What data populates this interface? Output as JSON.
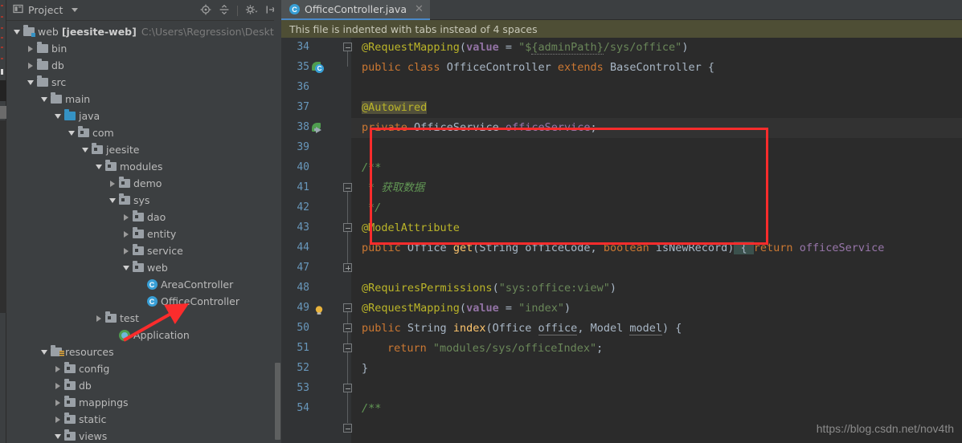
{
  "window": {
    "theme_bg": "#3c3f41",
    "editor_bg": "#2b2b2b",
    "accent": "#4a88c7",
    "highlight_box_color": "#fb2c2c"
  },
  "project_panel": {
    "title": "Project",
    "dropdown_icon": "chevron-down-icon",
    "toolbar_icons": [
      "target-locate-icon",
      "collapse-all-icon",
      "settings-gear-icon",
      "hide-panel-icon"
    ],
    "tree": [
      {
        "label": "web [jeesite-web]",
        "path_suffix": "C:\\Users\\Regression\\Desktop\\jee",
        "depth": 0,
        "twisty": "down",
        "icon": "module-folder-icon",
        "bold_part": "[jeesite-web]"
      },
      {
        "label": "bin",
        "depth": 1,
        "twisty": "right",
        "icon": "folder-icon"
      },
      {
        "label": "db",
        "depth": 1,
        "twisty": "right",
        "icon": "folder-icon"
      },
      {
        "label": "src",
        "depth": 1,
        "twisty": "down",
        "icon": "folder-icon"
      },
      {
        "label": "main",
        "depth": 2,
        "twisty": "down",
        "icon": "folder-icon"
      },
      {
        "label": "java",
        "depth": 3,
        "twisty": "down",
        "icon": "source-root-folder-icon"
      },
      {
        "label": "com",
        "depth": 4,
        "twisty": "down",
        "icon": "package-folder-icon"
      },
      {
        "label": "jeesite",
        "depth": 5,
        "twisty": "down",
        "icon": "package-folder-icon"
      },
      {
        "label": "modules",
        "depth": 6,
        "twisty": "down",
        "icon": "package-folder-icon"
      },
      {
        "label": "demo",
        "depth": 7,
        "twisty": "right",
        "icon": "package-folder-icon"
      },
      {
        "label": "sys",
        "depth": 7,
        "twisty": "down",
        "icon": "package-folder-icon"
      },
      {
        "label": "dao",
        "depth": 8,
        "twisty": "right",
        "icon": "package-folder-icon"
      },
      {
        "label": "entity",
        "depth": 8,
        "twisty": "right",
        "icon": "package-folder-icon"
      },
      {
        "label": "service",
        "depth": 8,
        "twisty": "right",
        "icon": "package-folder-icon"
      },
      {
        "label": "web",
        "depth": 8,
        "twisty": "down",
        "icon": "package-folder-icon"
      },
      {
        "label": "AreaController",
        "depth": 9,
        "twisty": "none",
        "icon": "java-class-icon"
      },
      {
        "label": "OfficeController",
        "depth": 9,
        "twisty": "none",
        "icon": "java-class-icon"
      },
      {
        "label": "test",
        "depth": 6,
        "twisty": "right",
        "icon": "package-folder-icon"
      },
      {
        "label": "Application",
        "depth": 7,
        "twisty": "none",
        "icon": "spring-application-icon"
      },
      {
        "label": "resources",
        "depth": 2,
        "twisty": "down",
        "icon": "resources-root-folder-icon"
      },
      {
        "label": "config",
        "depth": 3,
        "twisty": "right",
        "icon": "package-folder-icon"
      },
      {
        "label": "db",
        "depth": 3,
        "twisty": "right",
        "icon": "package-folder-icon"
      },
      {
        "label": "mappings",
        "depth": 3,
        "twisty": "right",
        "icon": "package-folder-icon"
      },
      {
        "label": "static",
        "depth": 3,
        "twisty": "right",
        "icon": "package-folder-icon"
      },
      {
        "label": "views",
        "depth": 3,
        "twisty": "down",
        "icon": "package-folder-icon"
      }
    ]
  },
  "editor": {
    "tab": {
      "label": "OfficeController.java",
      "icon": "java-class-icon",
      "close_icon": "close-icon"
    },
    "notification": "This file is indented with tabs instead of 4 spaces",
    "line_numbers": [
      34,
      35,
      36,
      37,
      38,
      39,
      40,
      41,
      42,
      43,
      44,
      47,
      48,
      49,
      50,
      51,
      52,
      53,
      54
    ],
    "current_line": 51,
    "code_lines": [
      "@RequestMapping(value = \"${adminPath}/sys/office\")",
      "public class OfficeController extends BaseController {",
      "",
      "@Autowired",
      "private OfficeService officeService;",
      "",
      "/**",
      "* 获取数据",
      "*/",
      "@ModelAttribute",
      "public Office get(String officeCode, boolean isNewRecord) { return officeService",
      "",
      "@RequiresPermissions(\"sys:office:view\")",
      "@RequestMapping(value = \"index\")",
      "public String index(Office office, Model model) {",
      "return \"modules/sys/officeIndex\";",
      "}",
      "",
      "/**"
    ],
    "gutter_markers": {
      "35": "spring-bean-class-icon",
      "38": "spring-bean-autowired-icon",
      "51": "intention-bulb-icon"
    }
  },
  "watermark": "https://blog.csdn.net/nov4th"
}
